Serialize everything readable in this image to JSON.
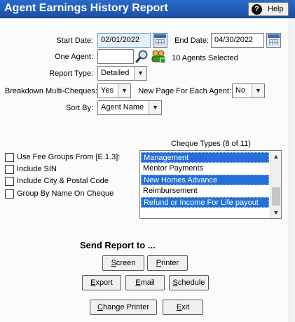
{
  "window": {
    "title": "Agent Earnings History Report",
    "help_label": "Help",
    "help_icon_glyph": "?"
  },
  "form": {
    "start_date_label": "Start Date:",
    "start_date_value": "02/01/2022",
    "end_date_label": "End Date:",
    "end_date_value": "04/30/2022",
    "one_agent_label": "One Agent:",
    "one_agent_value": "",
    "agents_selected": "10 Agents Selected",
    "report_type_label": "Report Type:",
    "report_type_value": "Detailed",
    "breakdown_label": "Breakdown Multi-Cheques:",
    "breakdown_value": "Yes",
    "new_page_label": "New Page For Each Agent:",
    "new_page_value": "No",
    "sort_by_label": "Sort By:",
    "sort_by_value": "Agent Name"
  },
  "options": [
    {
      "label": "Use Fee Groups From [E.1.3]:",
      "checked": false
    },
    {
      "label": "Include SIN",
      "checked": false
    },
    {
      "label": "Include City & Postal Code",
      "checked": false
    },
    {
      "label": "Group By Name On Cheque",
      "checked": false
    }
  ],
  "cheque_types": {
    "title": "Cheque Types (8 of 11)",
    "items": [
      {
        "label": "Management",
        "selected": true
      },
      {
        "label": "Mentor Payments",
        "selected": false
      },
      {
        "label": "New Homes Advance",
        "selected": true
      },
      {
        "label": "Reimbursement",
        "selected": false
      },
      {
        "label": "Refund or Income For Life payout",
        "selected": true
      }
    ]
  },
  "send": {
    "title": "Send Report to ...",
    "screen_first": "S",
    "screen_rest": "creen",
    "printer_first": "P",
    "printer_rest": "rinter",
    "export_first": "E",
    "export_rest": "xport",
    "email_first": "E",
    "email_rest": "mail",
    "schedule_first": "S",
    "schedule_rest": "chedule",
    "change_printer_first": "C",
    "change_printer_rest": "hange Printer",
    "exit_first": "E",
    "exit_rest": "xit"
  },
  "icons": {
    "calendar": "calendar-icon",
    "search": "search-icon",
    "agents": "agents-group-icon",
    "dropdown": "chevron-down-icon",
    "help": "help-icon"
  },
  "colors": {
    "titlebar": "#1b4fa6",
    "selection": "#2470d8",
    "date_field": "#e6f0fb"
  }
}
